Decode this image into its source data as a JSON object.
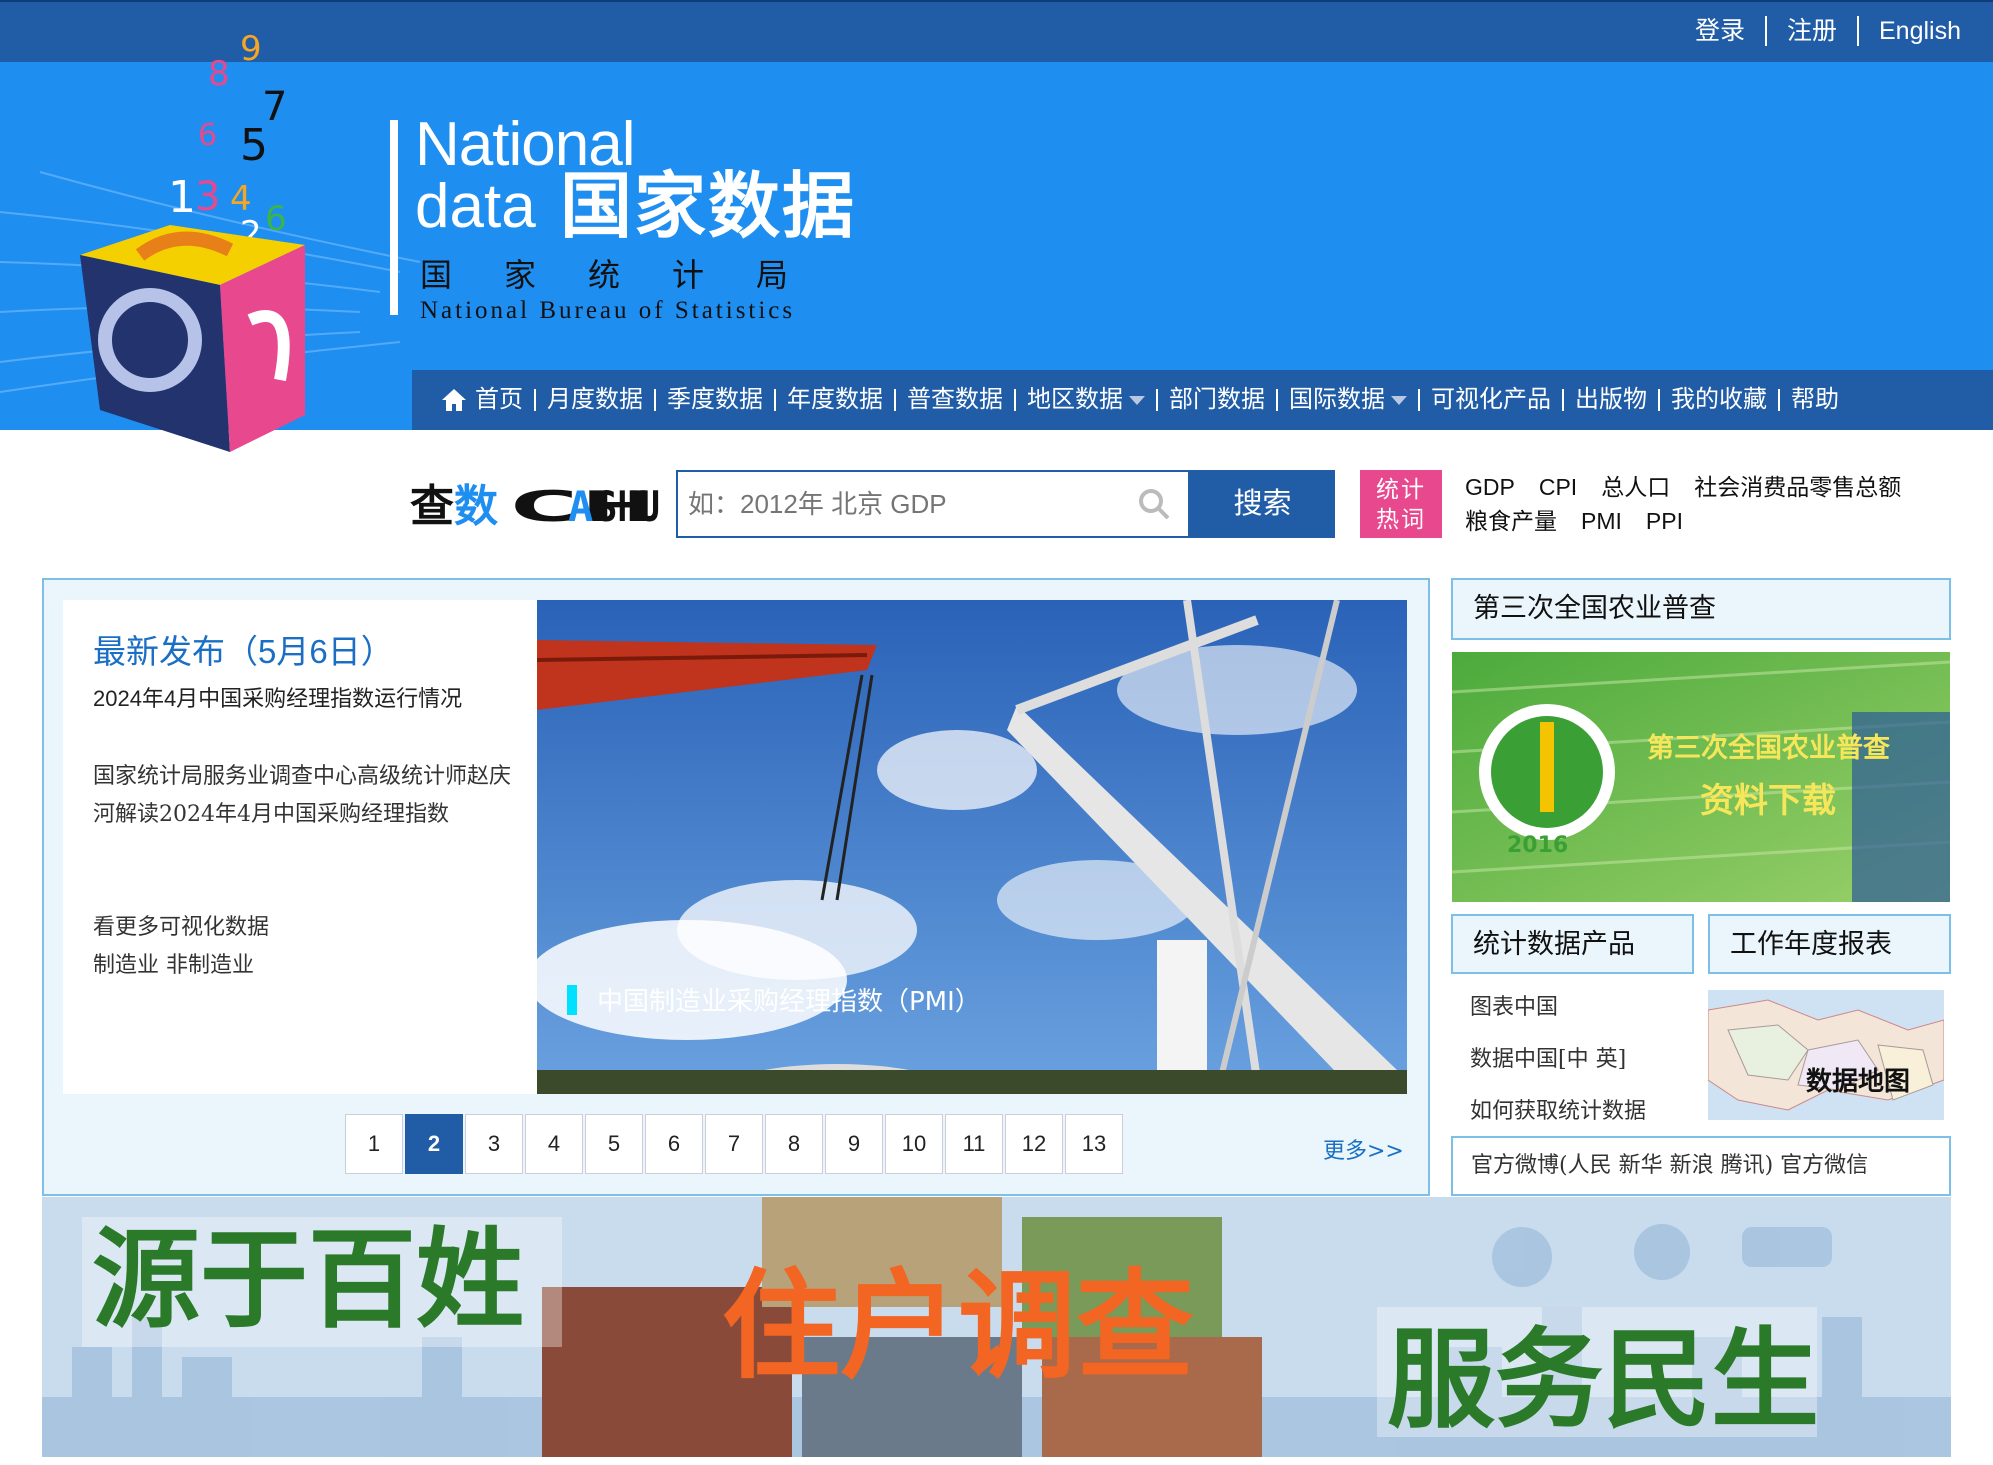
{
  "topbar": {
    "login": "登录",
    "register": "注册",
    "english": "English"
  },
  "logo": {
    "national": "National",
    "data": "data",
    "cn_name": "国家数据",
    "bureau_cn": "国家统计局",
    "bureau_en": "National Bureau of Statistics"
  },
  "nav": {
    "items": [
      "首页",
      "月度数据",
      "季度数据",
      "年度数据",
      "普查数据",
      "地区数据",
      "部门数据",
      "国际数据",
      "可视化产品",
      "出版物",
      "我的收藏",
      "帮助"
    ]
  },
  "search": {
    "brand": "查数CHASHU",
    "placeholder": "如：2012年 北京 GDP",
    "button": "搜索"
  },
  "hot": {
    "badge_line1": "统计",
    "badge_line2": "热词",
    "row1": [
      "GDP",
      "CPI",
      "总人口",
      "社会消费品零售总额"
    ],
    "row2": [
      "粮食产量",
      "PMI",
      "PPI"
    ]
  },
  "release": {
    "title": "最新发布（5月6日）",
    "headline": "2024年4月中国采购经理指数运行情况",
    "interpretation": "国家统计局服务业调查中心高级统计师赵庆河解读2024年4月中国采购经理指数",
    "viz_more": "看更多可视化数据",
    "link_manufacturing": "制造业",
    "link_nonmanufacturing": "非制造业",
    "photo_caption": "中国制造业采购经理指数（PMI）"
  },
  "pager": {
    "pages": [
      "1",
      "2",
      "3",
      "4",
      "5",
      "6",
      "7",
      "8",
      "9",
      "10",
      "11",
      "12",
      "13"
    ],
    "active": "2",
    "more": "更多>>"
  },
  "sidebar": {
    "census_title": "第三次全国农业普查",
    "census_banner_line1": "第三次全国农业普查",
    "census_banner_line2": "资料下载",
    "census_year": "2016",
    "products_title": "统计数据产品",
    "reports_title": "工作年度报表",
    "products": [
      "图表中国",
      "数据中国[中 英]",
      "如何获取统计数据"
    ],
    "map_label": "数据地图",
    "weibo": "官方微博(人民 新华 新浪 腾讯) 官方微信"
  },
  "banner": {
    "left": "源于百姓",
    "center": "住户调查",
    "right": "服务民生"
  },
  "colors": {
    "topbar": "#215ca6",
    "header": "#1f8ef1",
    "accent_link": "#1a6fc4",
    "hot_badge": "#e8488d",
    "panel_bg": "#eaf6fc"
  }
}
